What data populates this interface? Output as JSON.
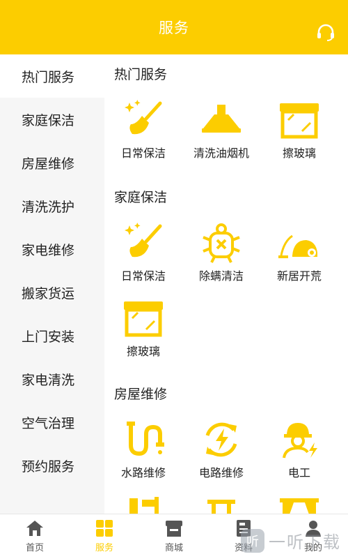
{
  "header": {
    "title": "服务",
    "headset_icon": "headset-icon"
  },
  "sidebar": {
    "items": [
      {
        "label": "热门服务",
        "active": true
      },
      {
        "label": "家庭保洁"
      },
      {
        "label": "房屋维修"
      },
      {
        "label": "清洗洗护"
      },
      {
        "label": "家电维修"
      },
      {
        "label": "搬家货运"
      },
      {
        "label": "上门安装"
      },
      {
        "label": "家电清洗"
      },
      {
        "label": "空气治理"
      },
      {
        "label": "预约服务"
      }
    ]
  },
  "sections": [
    {
      "title": "热门服务",
      "items": [
        {
          "label": "日常保洁",
          "icon": "broom-icon"
        },
        {
          "label": "清洗油烟机",
          "icon": "range-hood-icon"
        },
        {
          "label": "擦玻璃",
          "icon": "window-icon"
        }
      ]
    },
    {
      "title": "家庭保洁",
      "items": [
        {
          "label": "日常保洁",
          "icon": "broom-icon"
        },
        {
          "label": "除螨清洁",
          "icon": "mite-icon"
        },
        {
          "label": "新居开荒",
          "icon": "vacuum-icon"
        },
        {
          "label": "擦玻璃",
          "icon": "window-icon"
        }
      ]
    },
    {
      "title": "房屋维修",
      "items": [
        {
          "label": "水路维修",
          "icon": "pipe-icon"
        },
        {
          "label": "电路维修",
          "icon": "circuit-icon"
        },
        {
          "label": "电工",
          "icon": "electrician-icon"
        }
      ]
    }
  ],
  "tabbar": {
    "tabs": [
      {
        "label": "首页",
        "icon": "home-icon"
      },
      {
        "label": "服务",
        "icon": "grid-icon",
        "active": true
      },
      {
        "label": "商城",
        "icon": "shop-icon"
      },
      {
        "label": "资料",
        "icon": "document-icon"
      },
      {
        "label": "我的",
        "icon": "user-icon"
      }
    ]
  },
  "watermark": {
    "logo": "听",
    "text": "一听下载"
  },
  "colors": {
    "accent": "#fccd00",
    "sidebar_bg": "#f6f6f6",
    "text": "#222222"
  }
}
